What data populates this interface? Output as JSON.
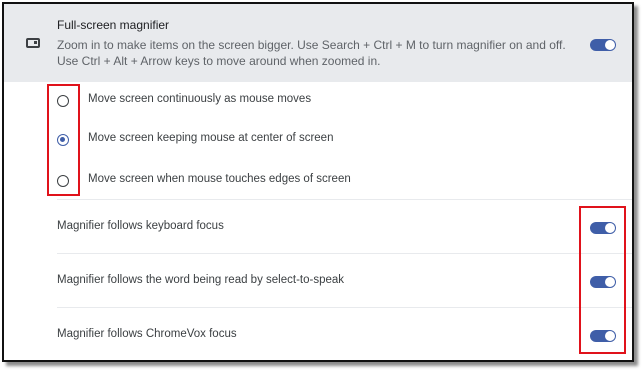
{
  "magnifier": {
    "title": "Full-screen magnifier",
    "description": "Zoom in to make items on the screen bigger. Use Search + Ctrl + M to turn magnifier on and off. Use Ctrl + Alt + Arrow keys to move around when zoomed in.",
    "enabled": true,
    "icon": "magnifier-icon"
  },
  "mouse_options": [
    {
      "label": "Move screen continuously as mouse moves",
      "selected": false
    },
    {
      "label": "Move screen keeping mouse at center of screen",
      "selected": true
    },
    {
      "label": "Move screen when mouse touches edges of screen",
      "selected": false
    }
  ],
  "toggles": [
    {
      "label": "Magnifier follows keyboard focus",
      "enabled": true
    },
    {
      "label": "Magnifier follows the word being read by select-to-speak",
      "enabled": true
    },
    {
      "label": "Magnifier follows ChromeVox focus",
      "enabled": true
    }
  ],
  "colors": {
    "accent": "#3f5ea8",
    "header_bg": "#e8eaed",
    "annotation": "#e0121b"
  }
}
